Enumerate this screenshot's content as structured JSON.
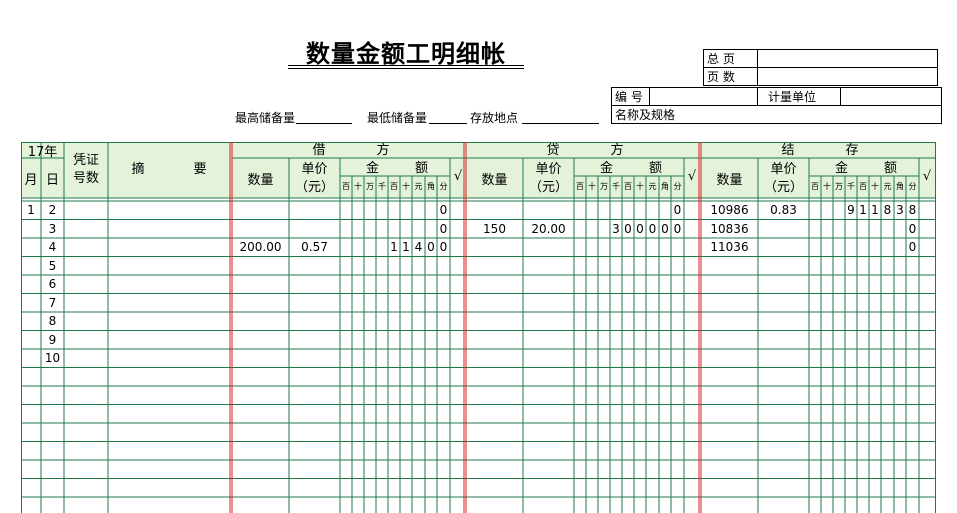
{
  "title": "数量金额工明细帐",
  "info": {
    "max_stock_label": "最高储备量",
    "min_stock_label": "最低储备量",
    "location_label": "存放地点"
  },
  "meta": {
    "total_pages_label": "总 页",
    "page_no_label": "页 数",
    "code_label": "编 号",
    "unit_label": "计量单位",
    "name_spec_label": "名称及规格"
  },
  "header": {
    "year": "17年",
    "month": "月",
    "day": "日",
    "voucher": "凭证号数",
    "voucher_l1": "凭证",
    "voucher_l2": "号数",
    "summary_a": "摘",
    "summary_b": "要",
    "debit_a": "借",
    "debit_b": "方",
    "credit_a": "贷",
    "credit_b": "方",
    "balance_a": "结",
    "balance_b": "存",
    "qty": "数量",
    "price_l1": "单价",
    "price_l2": "（元）",
    "amount_a": "金",
    "amount_b": "额",
    "check": "√",
    "digits": [
      "百",
      "十",
      "万",
      "千",
      "百",
      "十",
      "元",
      "角",
      "分"
    ]
  },
  "rows": [
    {
      "month": "1",
      "day": "2",
      "debit": {
        "qty": "",
        "price": "",
        "amount": "0"
      },
      "credit": {
        "qty": "",
        "price": "",
        "amount": "0"
      },
      "balance": {
        "qty": "10986",
        "price": "0.83",
        "amount": "911838"
      }
    },
    {
      "month": "",
      "day": "3",
      "debit": {
        "qty": "",
        "price": "",
        "amount": "0"
      },
      "credit": {
        "qty": "150",
        "price": "20.00",
        "amount": "300000"
      },
      "balance": {
        "qty": "10836",
        "price": "",
        "amount": "0"
      }
    },
    {
      "month": "",
      "day": "4",
      "debit": {
        "qty": "200.00",
        "price": "0.57",
        "amount": "11400"
      },
      "credit": {
        "qty": "",
        "price": "",
        "amount": ""
      },
      "balance": {
        "qty": "11036",
        "price": "",
        "amount": "0"
      }
    },
    {
      "month": "",
      "day": "5"
    },
    {
      "month": "",
      "day": "6"
    },
    {
      "month": "",
      "day": "7"
    },
    {
      "month": "",
      "day": "8"
    },
    {
      "month": "",
      "day": "9"
    },
    {
      "month": "",
      "day": "10"
    }
  ],
  "colors": {
    "grid": "#1f7a4a",
    "header_bg": "#e3f2d9",
    "divider": "#d62020"
  }
}
